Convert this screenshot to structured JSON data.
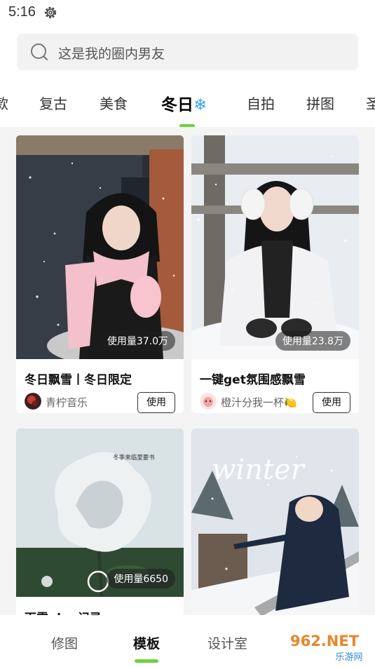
{
  "status_bar": {
    "time": "5:16"
  },
  "search": {
    "placeholder": "这是我的圈内男友"
  },
  "tabs": [
    {
      "label": "款"
    },
    {
      "label": "复古"
    },
    {
      "label": "美食"
    },
    {
      "label": "冬日",
      "emoji": "❄"
    },
    {
      "label": "自拍"
    },
    {
      "label": "拼图"
    },
    {
      "label": "圣"
    }
  ],
  "cards": [
    {
      "usage": "使用量37.0万",
      "title": "冬日飘雪丨冬日限定",
      "author": "青柠音乐",
      "button": "使用"
    },
    {
      "usage": "使用量23.8万",
      "title": "一键get氛围感飘雪",
      "author": "橙汁分我一杯",
      "author_emoji": "🍋",
      "button": "使用"
    },
    {
      "usage": "使用量6650",
      "title": "下雪plog记录",
      "overlay_text": "冬季来临里要书"
    },
    {
      "overlay_text": "winter"
    }
  ],
  "bottom_nav": [
    {
      "label": "修图"
    },
    {
      "label": "模板"
    },
    {
      "label": "设计室"
    }
  ],
  "watermark": {
    "top": "962.NET",
    "bottom": "乐游网"
  },
  "colors": {
    "accent": "#6fd13c",
    "snowflake": "#39a6e8"
  }
}
